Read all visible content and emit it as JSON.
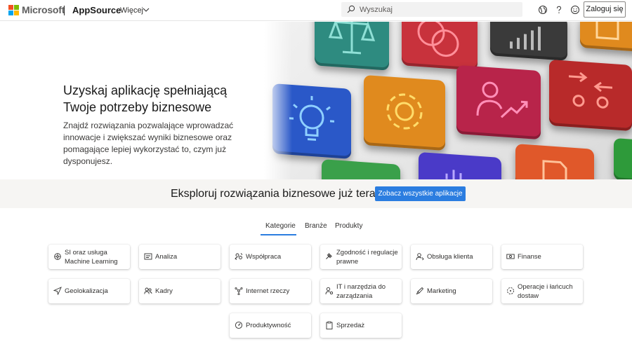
{
  "header": {
    "brand": "Microsoft",
    "product": "AppSource",
    "more_label": "Więcej",
    "search_placeholder": "Wyszukaj",
    "login_label": "Zaloguj się",
    "logo_colors": [
      "#f25022",
      "#7fba00",
      "#00a4ef",
      "#ffb900"
    ]
  },
  "hero": {
    "title": "Uzyskaj aplikację spełniającą Twoje potrzeby biznesowe",
    "description": "Znajdź rozwiązania pozwalające wprowadzać innowacje i zwiększać wyniki biznesowe oraz pomagające lepiej wykorzystać to, czym już dysponujesz.",
    "tile_colors": [
      "#2e8b80",
      "#c8323c",
      "#3a3a3a",
      "#e08a1e",
      "#2a58c8",
      "#e08a1e",
      "#b8244a",
      "#b82a2a",
      "#3aa04a",
      "#4a3ac8",
      "#e0582a",
      "#2e9a3a"
    ]
  },
  "explore": {
    "heading": "Eksploruj rozwiązania biznesowe już teraz",
    "button_label": "Zobacz wszystkie aplikacje",
    "accent": "#2b7de0"
  },
  "tabs": [
    {
      "label": "Kategorie",
      "active": true
    },
    {
      "label": "Branże",
      "active": false
    },
    {
      "label": "Produkty",
      "active": false
    }
  ],
  "categories": [
    {
      "label": "SI oraz usługa Machine Learning",
      "icon": "ai-brain-icon"
    },
    {
      "label": "Analiza",
      "icon": "analytics-icon"
    },
    {
      "label": "Współpraca",
      "icon": "collaboration-icon"
    },
    {
      "label": "Zgodność i regulacje prawne",
      "icon": "gavel-icon"
    },
    {
      "label": "Obsługa klienta",
      "icon": "customer-service-icon"
    },
    {
      "label": "Finanse",
      "icon": "money-icon"
    },
    {
      "label": "Geolokalizacja",
      "icon": "location-arrow-icon"
    },
    {
      "label": "Kadry",
      "icon": "people-icon"
    },
    {
      "label": "Internet rzeczy",
      "icon": "iot-icon"
    },
    {
      "label": "IT i narzędzia do zarządzania",
      "icon": "it-admin-icon"
    },
    {
      "label": "Marketing",
      "icon": "megaphone-icon"
    },
    {
      "label": "Operacje i łańcuch dostaw",
      "icon": "operations-icon"
    },
    {
      "label": "Produktywność",
      "icon": "speedometer-icon"
    },
    {
      "label": "Sprzedaż",
      "icon": "clipboard-icon"
    }
  ]
}
